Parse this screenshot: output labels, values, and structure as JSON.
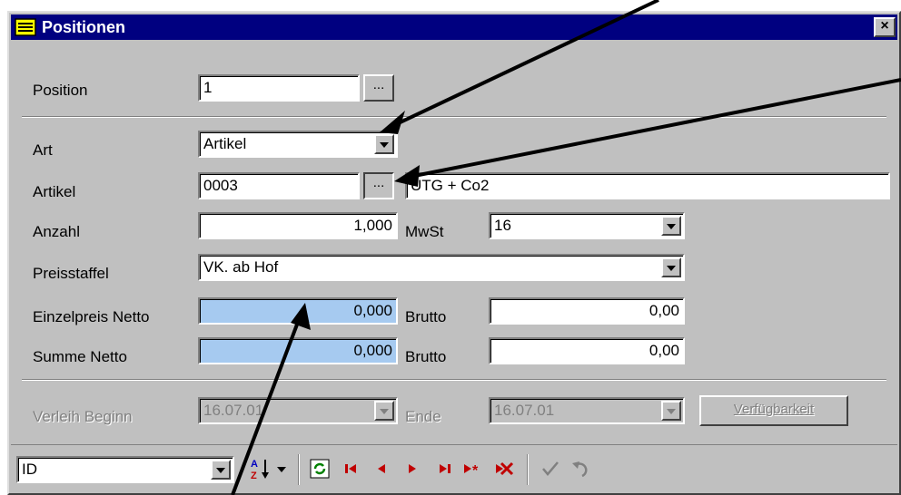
{
  "window": {
    "title": "Positionen",
    "close_label": "×"
  },
  "form": {
    "position_label": "Position",
    "position_value": "1",
    "position_lookup_label": "...",
    "art_label": "Art",
    "art_value": "Artikel",
    "artikel_label": "Artikel",
    "artikel_value": "0003",
    "artikel_lookup_label": "...",
    "artikel_description": "UTG + Co2",
    "anzahl_label": "Anzahl",
    "anzahl_value": "1,000",
    "mwst_label": "MwSt",
    "mwst_value": "16",
    "preisstaffel_label": "Preisstaffel",
    "preisstaffel_value": "VK. ab Hof",
    "einzelpreis_label": "Einzelpreis Netto",
    "einzelpreis_value": "0,000",
    "einzelpreis_brutto_label": "Brutto",
    "einzelpreis_brutto_value": "0,00",
    "summe_label": "Summe Netto",
    "summe_value": "0,000",
    "summe_brutto_label": "Brutto",
    "summe_brutto_value": "0,00",
    "verleih_label": "Verleih Beginn",
    "verleih_value": "16.07.01",
    "ende_label": "Ende",
    "ende_value": "16.07.01",
    "verfuegbarkeit_label": "Verfügbarkeit"
  },
  "toolbar": {
    "sort_field_value": "ID",
    "icons": [
      "sort-az-icon",
      "refresh-icon",
      "first-record-icon",
      "prev-record-icon",
      "next-record-icon",
      "last-record-icon",
      "new-record-icon",
      "delete-record-icon",
      "post-icon",
      "cancel-edit-icon"
    ]
  },
  "colors": {
    "title_bar": "#000080",
    "window_bg": "#c0c0c0",
    "highlight_field": "#a6caf0",
    "nav_icon": "#c00000"
  }
}
